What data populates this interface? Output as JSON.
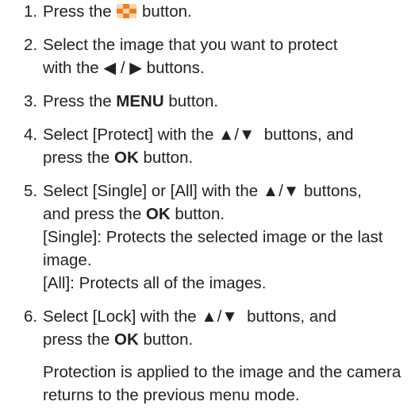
{
  "steps": [
    {
      "number": "1.",
      "before": "Press the",
      "icon": "playback-icon",
      "after": "button."
    },
    {
      "number": "2.",
      "line1": "Select the image that you want to protect",
      "line2_before": "with the ",
      "arrows": "◀ / ▶",
      "line2_after": " buttons."
    },
    {
      "number": "3.",
      "before": "Press the ",
      "bold": "MENU",
      "after": " button."
    },
    {
      "number": "4.",
      "line1_before": "Select [Protect] with the ",
      "arrows": "▲/▼",
      "line1_after": "  buttons, and",
      "line2_before": "press the ",
      "bold": "OK",
      "line2_after": " button."
    },
    {
      "number": "5.",
      "line1_before": "Select [Single] or [All] with the ",
      "arrows": "▲/▼",
      "line1_after": " buttons,",
      "line2_before": "and press the ",
      "bold": "OK",
      "line2_after": " button.",
      "note1": "[Single]: Protects the selected image or the last image.",
      "note2": "[All]: Protects all of the images."
    },
    {
      "number": "6.",
      "line1_before": "Select [Lock] with the ",
      "arrows": "▲/▼",
      "line1_after": "  buttons, and",
      "line2_before": "press the ",
      "bold": "OK",
      "line2_after": " button.",
      "result": "Protection is applied to the image and the camera returns to the previous menu mode."
    }
  ],
  "colors": {
    "text": "#222222",
    "icon_orange": "#f07c1c",
    "icon_light": "#fbd4b2"
  }
}
